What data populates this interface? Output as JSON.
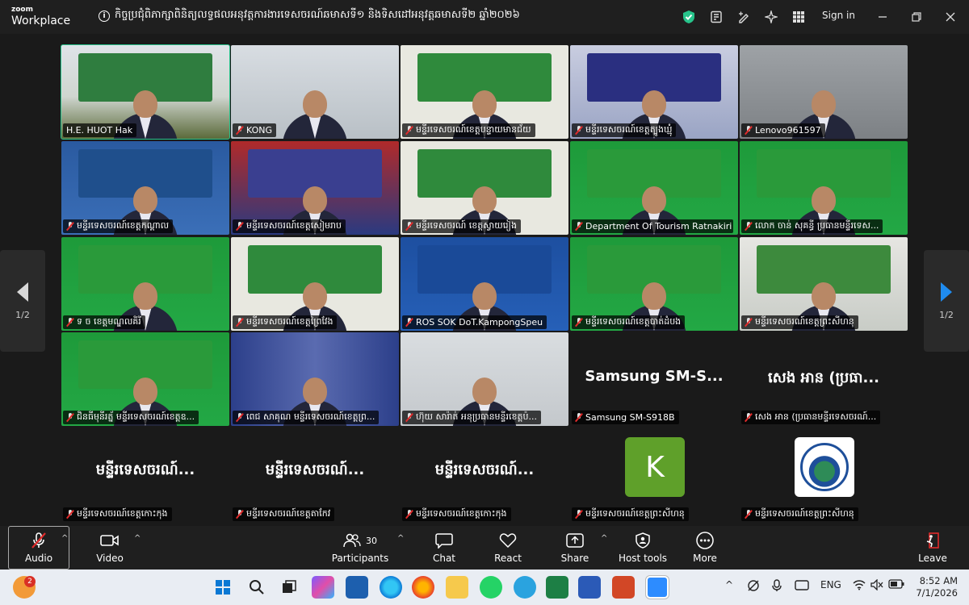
{
  "app": {
    "brand_line1": "zoom",
    "brand_line2": "Workplace"
  },
  "meeting": {
    "title": "កិច្ចប្រជុំពិភាក្សាពិនិត្យលទ្ធផលអនុវត្តការងារទេសចរណ៍ឆមាសទី១ និងទិសដៅអនុវត្តឆមាសទី២ ឆ្នាំ២០២៦"
  },
  "titlebar": {
    "signin_label": "Sign in"
  },
  "participants_grid": [
    {
      "name": "H.E. HUOT Hak",
      "muted": false,
      "theme": "meeting"
    },
    {
      "name": "KONG",
      "muted": true,
      "theme": "office"
    },
    {
      "name": "មន្ទីរទេសចរណ៍ខេត្តបន្ទាយមានជ័យ",
      "muted": true,
      "theme": "greenboard"
    },
    {
      "name": "មន្ទីរទេសចរណ៍ខេត្តត្បូងឃ្មុំ",
      "muted": true,
      "theme": "bluehall"
    },
    {
      "name": "Lenovo961597",
      "muted": true,
      "theme": "grey"
    },
    {
      "name": "មន្ទីរទេសចរណ៍ខេត្តកណ្ដាល",
      "muted": true,
      "theme": "bluewall"
    },
    {
      "name": "មន្ទីរទេសចរណ៍ខេត្តសៀមរាប",
      "muted": true,
      "theme": "redwall"
    },
    {
      "name": "មន្ទីរទេសចរណ៍ ខេត្តស្វាយរៀង",
      "muted": true,
      "theme": "greenboard"
    },
    {
      "name": "Department Of Tourism Ratnakiri",
      "muted": true,
      "theme": "green"
    },
    {
      "name": "លោក ចាន់ សុគន្ធី ប្រធានមន្ទីរទេស...",
      "muted": true,
      "theme": "green"
    },
    {
      "name": "ទ ច ខេត្តមណ្ឌលគិរី",
      "muted": true,
      "theme": "green"
    },
    {
      "name": "មន្ទីរទេសចរណ៍ខេត្តព្រៃវែង",
      "muted": true,
      "theme": "greenboard"
    },
    {
      "name": "ROS SOK DoT.KampongSpeu",
      "muted": true,
      "theme": "blue"
    },
    {
      "name": "មន្ទីរទេសចរណ៍ខេត្តបាត់ដំបង",
      "muted": true,
      "theme": "green"
    },
    {
      "name": "មន្ទីរទេសចរណ៍ខេត្តព្រះសីហនុ",
      "muted": true,
      "theme": "room"
    },
    {
      "name": "ជិនធីមុនីរត្ន័ មន្ទីរទេសចរណ៍ខេត្តឧ...",
      "muted": true,
      "theme": "green"
    },
    {
      "name": "ពេជ សាគុណ មន្ទីរទេសចរណ៍ខេត្តព្រ...",
      "muted": true,
      "theme": "curtain"
    },
    {
      "name": "ហ៊ុយ សារ៉ាត់ អនុប្រធានមន្ទីរខេត្តប៉...",
      "muted": true,
      "theme": "light"
    },
    {
      "name": "Samsung SM-S918B",
      "muted": true,
      "theme": "dark",
      "big_label": "Samsung  SM-S..."
    },
    {
      "name": "សេង អាន (ប្រធានមន្ទីរទេសចរណ៍...",
      "muted": true,
      "theme": "dark",
      "big_label": "សេង អាន (ប្រធា..."
    }
  ],
  "participants_noncam": [
    {
      "name": "មន្ទីរទេសចរណ៍ខេត្តកោះកុង",
      "big_label": "មន្ទីរទេសចរណ៍...",
      "avatar": ""
    },
    {
      "name": "មន្ទីរទេសចរណ៍ខេត្តតាកែវ",
      "big_label": "មន្ទីរទេសចរណ៍...",
      "avatar": ""
    },
    {
      "name": "មន្ទីរទេសចរណ៍ខេត្តកោះកុង",
      "big_label": "មន្ទីរទេសចរណ៍...",
      "avatar": ""
    },
    {
      "name": "មន្ទីរទេសចរណ៍ខេត្តព្រះសីហនុ",
      "big_label": "",
      "avatar": "K"
    },
    {
      "name": "មន្ទីរទេសចរណ៍ខេត្តព្រះសីហនុ",
      "big_label": "",
      "avatar": "logo"
    }
  ],
  "pager": {
    "left_label": "1/2",
    "right_label": "1/2"
  },
  "toolbar": {
    "audio": "Audio",
    "video": "Video",
    "participants": "Participants",
    "participants_count": "30",
    "chat": "Chat",
    "react": "React",
    "share": "Share",
    "host_tools": "Host tools",
    "more": "More",
    "leave": "Leave"
  },
  "taskbar": {
    "notification_count": "2",
    "lang": "ENG",
    "time": "8:52 AM",
    "date": "7/1/2026"
  },
  "colors": {
    "active_speaker": "#27c48b",
    "leave_red": "#e02b2b",
    "pager_arrow": "#1f8cf0"
  }
}
